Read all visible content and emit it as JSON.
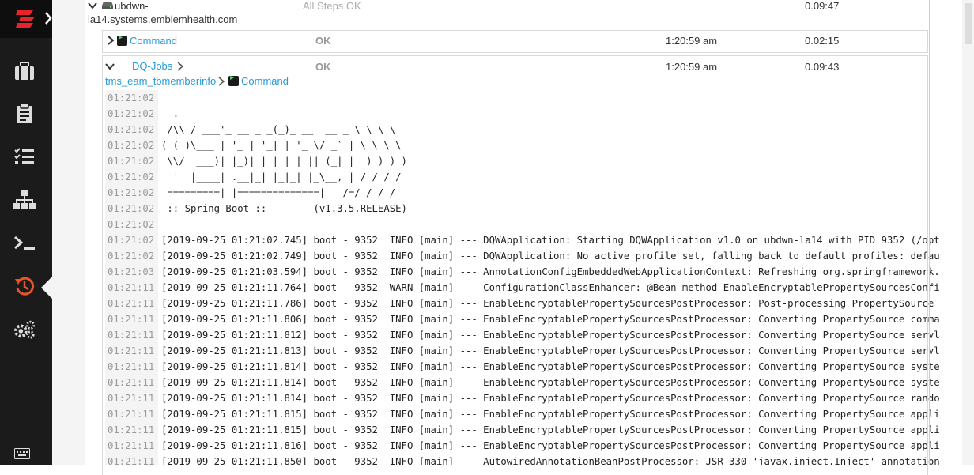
{
  "host": {
    "name_line1": "ubdwn-",
    "name_line2": "la14.systems.emblemhealth.com",
    "status": "All Steps OK",
    "duration": "0.09:47"
  },
  "step1": {
    "label": "Command",
    "status": "OK",
    "time": "1:20:59 am",
    "duration": "0.02:15"
  },
  "step2": {
    "label": "DQ-Jobs",
    "sub_label": "tms_eam_tbmemberinfo",
    "command_label": "Command",
    "status": "OK",
    "time": "1:20:59 am",
    "duration": "0.09:43"
  },
  "log_lines": [
    {
      "ts": "01:21:02",
      "msg": ""
    },
    {
      "ts": "01:21:02",
      "msg": "  .   ____          _            __ _ _"
    },
    {
      "ts": "01:21:02",
      "msg": " /\\\\ / ___'_ __ _ _(_)_ __  __ _ \\ \\ \\ \\"
    },
    {
      "ts": "01:21:02",
      "msg": "( ( )\\___ | '_ | '_| | '_ \\/ _` | \\ \\ \\ \\"
    },
    {
      "ts": "01:21:02",
      "msg": " \\\\/  ___)| |_)| | | | | || (_| |  ) ) ) )"
    },
    {
      "ts": "01:21:02",
      "msg": "  '  |____| .__|_| |_|_| |_\\__, | / / / /"
    },
    {
      "ts": "01:21:02",
      "msg": " =========|_|==============|___/=/_/_/_/"
    },
    {
      "ts": "01:21:02",
      "msg": " :: Spring Boot ::        (v1.3.5.RELEASE)"
    },
    {
      "ts": "01:21:02",
      "msg": ""
    },
    {
      "ts": "01:21:02",
      "msg": "[2019-09-25 01:21:02.745] boot - 9352  INFO [main] --- DQWApplication: Starting DQWApplication v1.0 on ubdwn-la14 with PID 9352 (/opt"
    },
    {
      "ts": "01:21:02",
      "msg": "[2019-09-25 01:21:02.749] boot - 9352  INFO [main] --- DQWApplication: No active profile set, falling back to default profiles: defau"
    },
    {
      "ts": "01:21:03",
      "msg": "[2019-09-25 01:21:03.594] boot - 9352  INFO [main] --- AnnotationConfigEmbeddedWebApplicationContext: Refreshing org.springframework."
    },
    {
      "ts": "01:21:11",
      "msg": "[2019-09-25 01:21:11.764] boot - 9352  WARN [main] --- ConfigurationClassEnhancer: @Bean method EnableEncryptablePropertySourcesConfi"
    },
    {
      "ts": "01:21:11",
      "msg": "[2019-09-25 01:21:11.786] boot - 9352  INFO [main] --- EnableEncryptablePropertySourcesPostProcessor: Post-processing PropertySource "
    },
    {
      "ts": "01:21:11",
      "msg": "[2019-09-25 01:21:11.806] boot - 9352  INFO [main] --- EnableEncryptablePropertySourcesPostProcessor: Converting PropertySource comma"
    },
    {
      "ts": "01:21:11",
      "msg": "[2019-09-25 01:21:11.812] boot - 9352  INFO [main] --- EnableEncryptablePropertySourcesPostProcessor: Converting PropertySource servl"
    },
    {
      "ts": "01:21:11",
      "msg": "[2019-09-25 01:21:11.813] boot - 9352  INFO [main] --- EnableEncryptablePropertySourcesPostProcessor: Converting PropertySource servl"
    },
    {
      "ts": "01:21:11",
      "msg": "[2019-09-25 01:21:11.814] boot - 9352  INFO [main] --- EnableEncryptablePropertySourcesPostProcessor: Converting PropertySource syste"
    },
    {
      "ts": "01:21:11",
      "msg": "[2019-09-25 01:21:11.814] boot - 9352  INFO [main] --- EnableEncryptablePropertySourcesPostProcessor: Converting PropertySource syste"
    },
    {
      "ts": "01:21:11",
      "msg": "[2019-09-25 01:21:11.814] boot - 9352  INFO [main] --- EnableEncryptablePropertySourcesPostProcessor: Converting PropertySource rando"
    },
    {
      "ts": "01:21:11",
      "msg": "[2019-09-25 01:21:11.815] boot - 9352  INFO [main] --- EnableEncryptablePropertySourcesPostProcessor: Converting PropertySource appli"
    },
    {
      "ts": "01:21:11",
      "msg": "[2019-09-25 01:21:11.815] boot - 9352  INFO [main] --- EnableEncryptablePropertySourcesPostProcessor: Converting PropertySource appli"
    },
    {
      "ts": "01:21:11",
      "msg": "[2019-09-25 01:21:11.816] boot - 9352  INFO [main] --- EnableEncryptablePropertySourcesPostProcessor: Converting PropertySource appli"
    },
    {
      "ts": "01:21:11",
      "msg": "[2019-09-25 01:21:11.850] boot - 9352  INFO [main] --- AutowiredAnnotationBeanPostProcessor: JSR-330 'javax.inject.Inject' annotation"
    }
  ],
  "nav": {
    "items": [
      "briefcase-icon",
      "clipboard-icon",
      "tasks-icon",
      "sitemap-icon",
      "terminal-icon",
      "history-icon",
      "settings-icon"
    ],
    "active": "history-icon",
    "accent": "#e8552b"
  }
}
